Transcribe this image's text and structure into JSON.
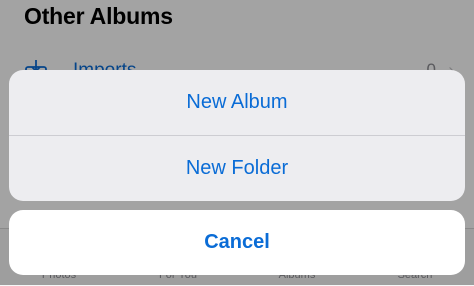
{
  "background": {
    "section_title": "Other Albums",
    "row": {
      "label": "Imports",
      "count": "0",
      "chevron": "›",
      "icon": "import-icon"
    },
    "tabs": [
      {
        "label": "Photos"
      },
      {
        "label": "For You"
      },
      {
        "label": "Albums"
      },
      {
        "label": "Search"
      }
    ]
  },
  "action_sheet": {
    "actions": [
      {
        "label": "New Album"
      },
      {
        "label": "New Folder"
      }
    ],
    "cancel_label": "Cancel"
  },
  "colors": {
    "accent": "#0a6cd6",
    "sheet_background": "#ededf0",
    "cancel_background": "#ffffff",
    "dim_overlay": "rgba(0,0,0,0.36)"
  }
}
